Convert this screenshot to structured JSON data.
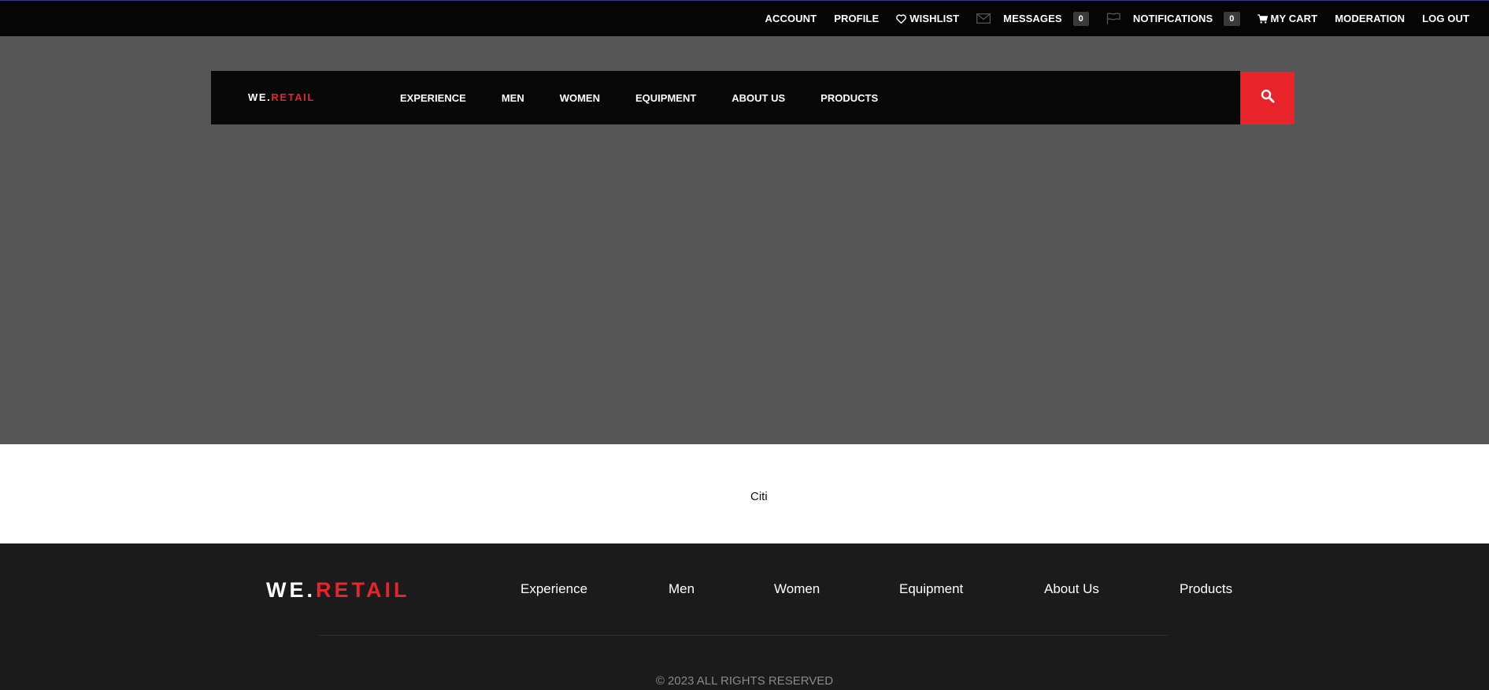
{
  "topbar": {
    "account": "ACCOUNT",
    "profile": "PROFILE",
    "wishlist": "WISHLIST",
    "messages": "MESSAGES",
    "messages_count": "0",
    "notifications": "NOTIFICATIONS",
    "notifications_count": "0",
    "cart": "MY CART",
    "moderation": "MODERATION",
    "logout": "LOG OUT"
  },
  "brand": {
    "prefix": "WE.",
    "suffix": "RETAIL",
    "accent": "#e8232a"
  },
  "nav": {
    "items": [
      "EXPERIENCE",
      "MEN",
      "WOMEN",
      "EQUIPMENT",
      "ABOUT US",
      "PRODUCTS"
    ]
  },
  "search": {
    "icon": "search-icon"
  },
  "content": {
    "text": "Citi"
  },
  "footer": {
    "items": [
      "Experience",
      "Men",
      "Women",
      "Equipment",
      "About Us",
      "Products"
    ],
    "copyright": "© 2023 ALL RIGHTS RESERVED"
  }
}
